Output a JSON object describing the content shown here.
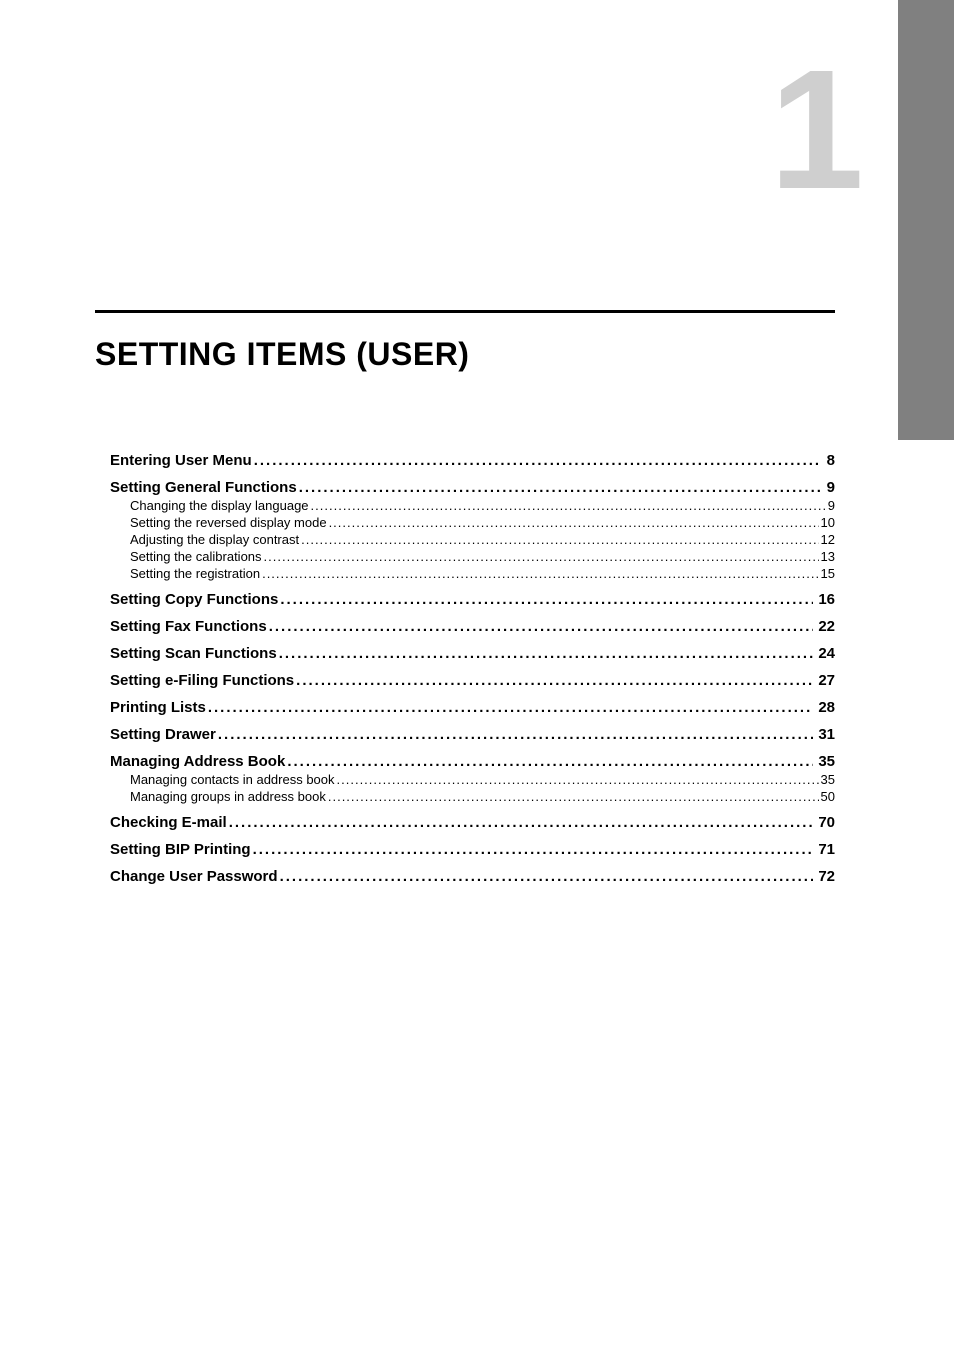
{
  "chapter_number": "1",
  "chapter_title": "SETTING ITEMS (USER)",
  "toc": [
    {
      "level": "major",
      "label": "Entering User Menu",
      "page": "8"
    },
    {
      "level": "major",
      "label": "Setting General Functions",
      "page": "9"
    },
    {
      "level": "minor",
      "label": "Changing the display language",
      "page": "9"
    },
    {
      "level": "minor",
      "label": "Setting the reversed display mode",
      "page": "10"
    },
    {
      "level": "minor",
      "label": "Adjusting the display contrast",
      "page": "12"
    },
    {
      "level": "minor",
      "label": "Setting the calibrations",
      "page": "13"
    },
    {
      "level": "minor",
      "label": "Setting the registration",
      "page": "15"
    },
    {
      "level": "major",
      "label": "Setting Copy Functions",
      "page": "16"
    },
    {
      "level": "major",
      "label": "Setting Fax Functions",
      "page": "22"
    },
    {
      "level": "major",
      "label": "Setting Scan Functions",
      "page": "24"
    },
    {
      "level": "major",
      "label": "Setting e-Filing Functions",
      "page": "27"
    },
    {
      "level": "major",
      "label": "Printing Lists",
      "page": "28"
    },
    {
      "level": "major",
      "label": "Setting Drawer",
      "page": "31"
    },
    {
      "level": "major",
      "label": "Managing Address Book",
      "page": "35"
    },
    {
      "level": "minor",
      "label": "Managing contacts in address book",
      "page": "35"
    },
    {
      "level": "minor",
      "label": "Managing groups in address book",
      "page": "50"
    },
    {
      "level": "major",
      "label": "Checking E-mail",
      "page": "70"
    },
    {
      "level": "major",
      "label": "Setting BIP Printing",
      "page": "71"
    },
    {
      "level": "major",
      "label": "Change User Password",
      "page": "72"
    }
  ]
}
